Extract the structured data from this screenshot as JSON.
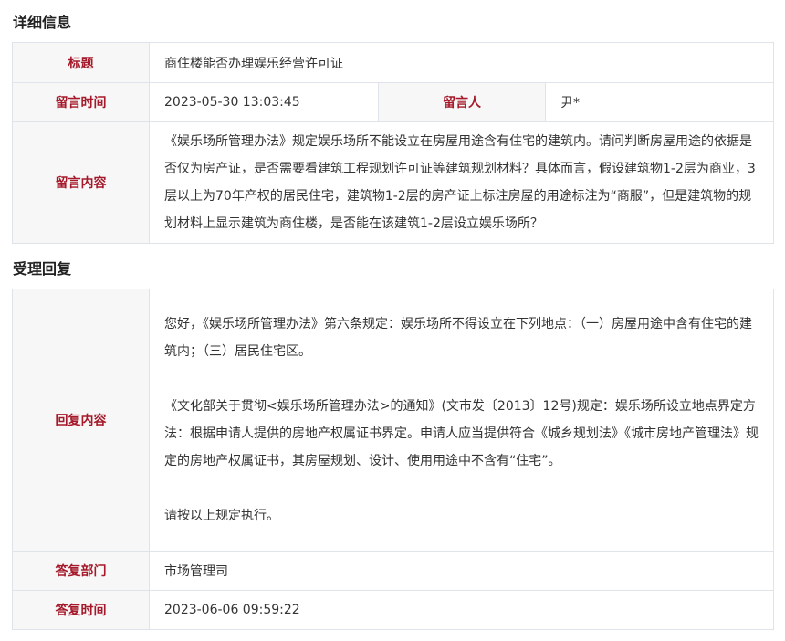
{
  "detail": {
    "section_title": "详细信息",
    "title_label": "标题",
    "title_value": "商住楼能否办理娱乐经营许可证",
    "time_label": "留言时间",
    "time_value": "2023-05-30 13:03:45",
    "author_label": "留言人",
    "author_value": "尹*",
    "content_label": "留言内容",
    "content_value": "《娱乐场所管理办法》规定娱乐场所不能设立在房屋用途含有住宅的建筑内。请问判断房屋用途的依据是否仅为房产证，是否需要看建筑工程规划许可证等建筑规划材料？具体而言，假设建筑物1-2层为商业，3层以上为70年产权的居民住宅，建筑物1-2层的房产证上标注房屋的用途标注为“商服”，但是建筑物的规划材料上显示建筑为商住楼，是否能在该建筑1-2层设立娱乐场所？"
  },
  "reply": {
    "section_title": "受理回复",
    "content_label": "回复内容",
    "paragraphs": [
      "您好，《娱乐场所管理办法》第六条规定：娱乐场所不得设立在下列地点：（一）房屋用途中含有住宅的建筑内；（三）居民住宅区。",
      "《文化部关于贯彻<娱乐场所管理办法>的通知》(文市发〔2013〕12号)规定：娱乐场所设立地点界定方法：根据申请人提供的房地产权属证书界定。申请人应当提供符合《城乡规划法》《城市房地产管理法》规定的房地产权属证书，其房屋规划、设计、使用用途中不含有“住宅”。",
      "请按以上规定执行。"
    ],
    "dept_label": "答复部门",
    "dept_value": "市场管理司",
    "time_label": "答复时间",
    "time_value": "2023-06-06 09:59:22"
  }
}
